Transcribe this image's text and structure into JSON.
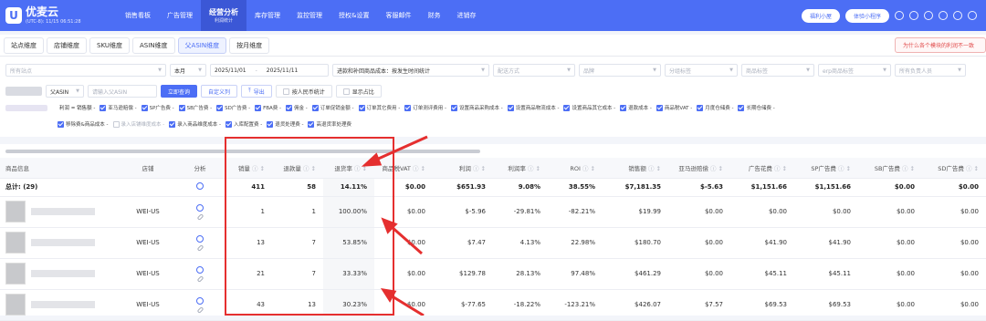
{
  "brand": {
    "name": "优麦云",
    "server_time": "(UTC-8): 11/15 06:51:28"
  },
  "nav": [
    {
      "label": "销售看板"
    },
    {
      "label": "广告管理"
    },
    {
      "label": "经营分析",
      "sub": "利润统计",
      "active": true
    },
    {
      "label": "库存管理"
    },
    {
      "label": "监控管理"
    },
    {
      "label": "授权&设置"
    },
    {
      "label": "客服邮件"
    },
    {
      "label": "财务"
    },
    {
      "label": "进销存"
    }
  ],
  "top_right": {
    "btn1": "福利小屋",
    "btn2": "体验小程序"
  },
  "tabs": [
    {
      "label": "站点维度"
    },
    {
      "label": "店铺维度"
    },
    {
      "label": "SKU维度"
    },
    {
      "label": "ASIN维度"
    },
    {
      "label": "父ASIN维度",
      "active": true
    },
    {
      "label": "按月维度"
    }
  ],
  "tab_link": "为什么各个模块的利润不一致",
  "filters": {
    "site_placeholder": "所有站点",
    "period": "本月",
    "date_from": "2025/11/01",
    "date_to": "2025/11/11",
    "cost_mode": "进款和补回商品成本：按发生时间统计",
    "delivery": "配送方式",
    "brand": "品牌",
    "category_tag": "分组标签",
    "product_tag": "商品标签",
    "erp_tag": "erp商品标签",
    "owner": "所有负责人员",
    "asin_type": "父ASIN",
    "search_placeholder": "请输入父ASIN",
    "btn_query": "立即查询",
    "btn_custom": "自定义列",
    "btn_export": "导出",
    "chk_rmb": "按人民币统计",
    "chk_point": "显示占比"
  },
  "formula": {
    "prefix": "利润 = 销售额 -",
    "items": [
      {
        "label": "亚马逊赔偿 -",
        "on": true
      },
      {
        "label": "SP广告费 -",
        "on": true
      },
      {
        "label": "SB广告费 -",
        "on": true
      },
      {
        "label": "SD广告费 -",
        "on": true
      },
      {
        "label": "FBA费 -",
        "on": true
      },
      {
        "label": "佣金 -",
        "on": true
      },
      {
        "label": "订单促销金额 -",
        "on": true
      },
      {
        "label": "订单其它费用 -",
        "on": true
      },
      {
        "label": "订单测评费用 -",
        "on": true
      },
      {
        "label": "设置商品采购成本 -",
        "on": true
      },
      {
        "label": "设置商品物流成本 -",
        "on": true
      },
      {
        "label": "设置商品其它成本 -",
        "on": true
      },
      {
        "label": "退款成本 -",
        "on": true
      },
      {
        "label": "商品税VAT -",
        "on": true
      },
      {
        "label": "月度仓储费 -",
        "on": true
      },
      {
        "label": "长期仓储费 -",
        "on": true
      }
    ],
    "items2": [
      {
        "label": "移除费&商品成本 -",
        "on": true
      },
      {
        "label": "录入店铺维度成本 -",
        "on": false
      },
      {
        "label": "录入商品维度成本 -",
        "on": true
      },
      {
        "label": "入库配置费 -",
        "on": true
      },
      {
        "label": "退货处理费 -",
        "on": true
      },
      {
        "label": "高退货率处理费",
        "on": true
      }
    ]
  },
  "table": {
    "headers": [
      "商品信息",
      "店铺",
      "分析",
      "销量",
      "退款量",
      "退货率",
      "商品税VAT",
      "利润",
      "利润率",
      "ROI",
      "销售额",
      "亚马逊赔偿",
      "广告花费",
      "SP广告费",
      "SB广告费",
      "SD广告费"
    ],
    "total": {
      "label": "总计: (29)",
      "sales": "411",
      "refunds": "58",
      "rate": "14.11%",
      "vat": "$0.00",
      "profit": "$651.93",
      "margin": "9.08%",
      "roi": "38.55%",
      "revenue": "$7,181.35",
      "comp": "$-5.63",
      "ad": "$1,151.66",
      "sp": "$1,151.66",
      "sb": "$0.00",
      "sd": "$0.00"
    },
    "rows": [
      {
        "shop": "WEI-US",
        "sales": "1",
        "refunds": "1",
        "rate": "100.00%",
        "vat": "$0.00",
        "profit": "$-5.96",
        "margin": "-29.81%",
        "roi": "-82.21%",
        "revenue": "$19.99",
        "comp": "$0.00",
        "ad": "$0.00",
        "sp": "$0.00",
        "sb": "$0.00",
        "sd": "$0.00"
      },
      {
        "shop": "WEI-US",
        "sales": "13",
        "refunds": "7",
        "rate": "53.85%",
        "vat": "$0.00",
        "profit": "$7.47",
        "margin": "4.13%",
        "roi": "22.98%",
        "revenue": "$180.70",
        "comp": "$0.00",
        "ad": "$41.90",
        "sp": "$41.90",
        "sb": "$0.00",
        "sd": "$0.00"
      },
      {
        "shop": "WEI-US",
        "sales": "21",
        "refunds": "7",
        "rate": "33.33%",
        "vat": "$0.00",
        "profit": "$129.78",
        "margin": "28.13%",
        "roi": "97.48%",
        "revenue": "$461.29",
        "comp": "$0.00",
        "ad": "$45.11",
        "sp": "$45.11",
        "sb": "$0.00",
        "sd": "$0.00"
      },
      {
        "shop": "WEI-US",
        "sales": "43",
        "refunds": "13",
        "rate": "30.23%",
        "vat": "$0.00",
        "profit": "$-77.65",
        "margin": "-18.22%",
        "roi": "-123.21%",
        "revenue": "$426.07",
        "comp": "$7.57",
        "ad": "$69.53",
        "sp": "$69.53",
        "sb": "$0.00",
        "sd": "$0.00"
      }
    ]
  },
  "colors": {
    "primary": "#4c6ef5",
    "annotation": "#e52f2f"
  }
}
